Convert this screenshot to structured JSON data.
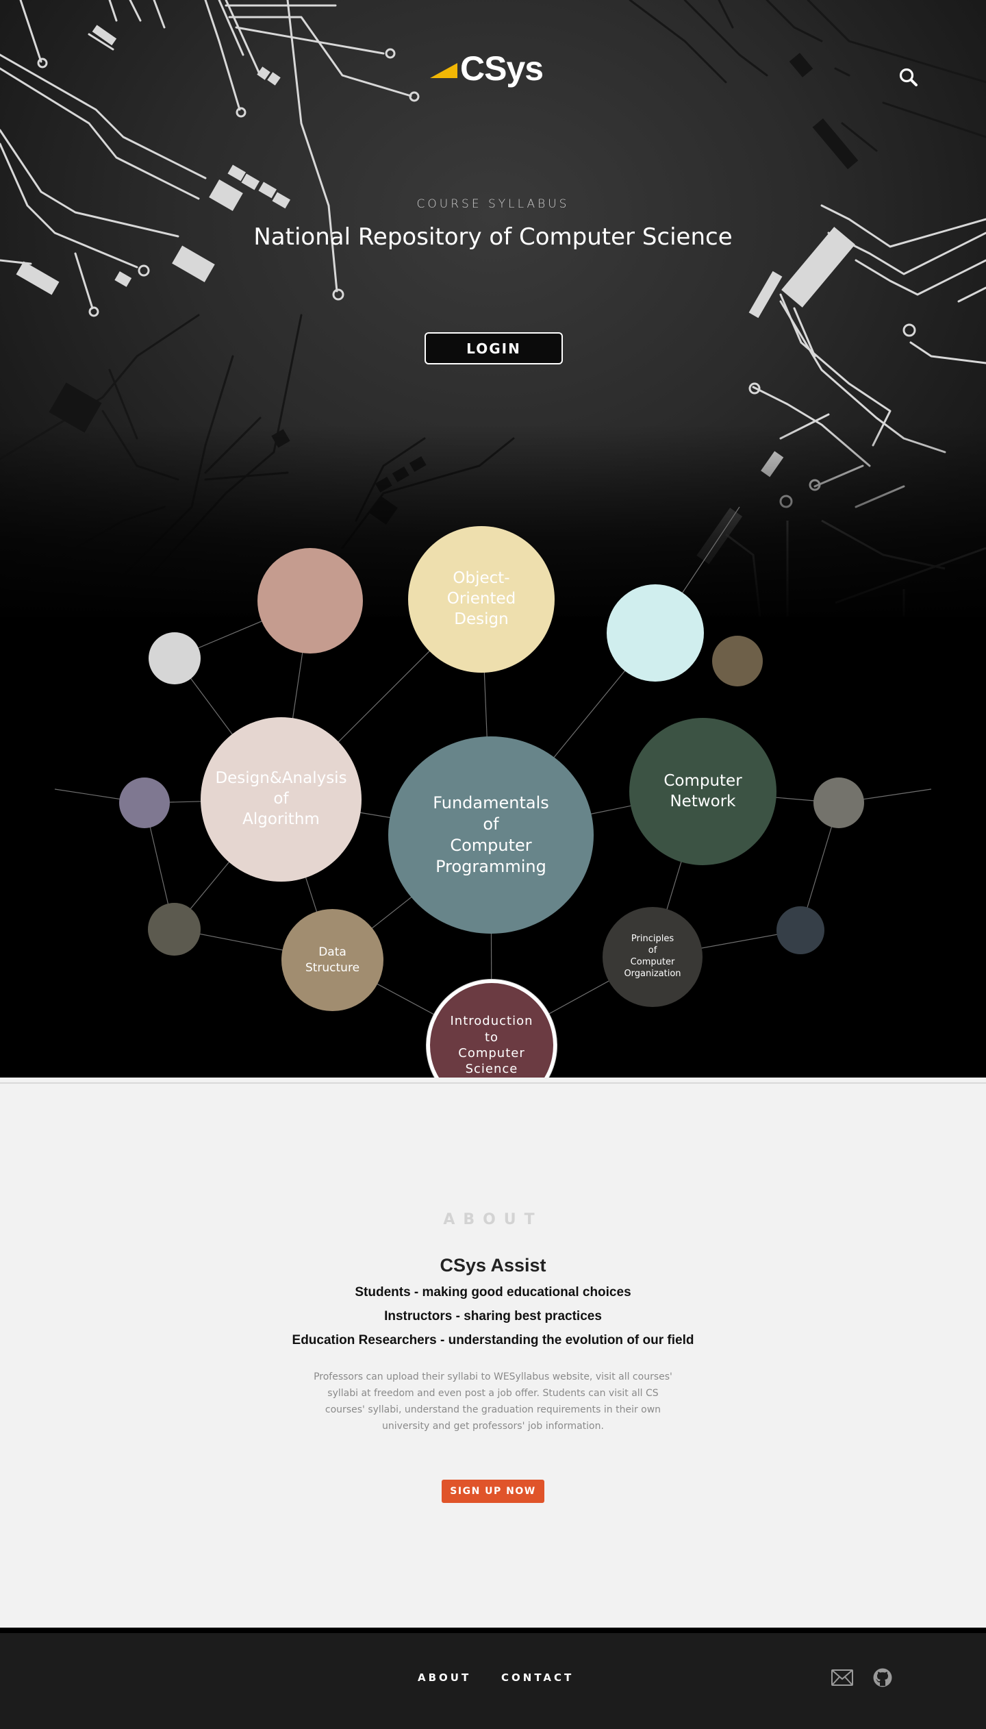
{
  "brand": {
    "name": "CSys",
    "accent": "#f2b705"
  },
  "header": {
    "search_icon": "search-icon"
  },
  "hero": {
    "eyebrow": "COURSE SYLLABUS",
    "title": "National Repository of Computer Science",
    "login_label": "LOGIN"
  },
  "courses": {
    "fundamentals": [
      "Fundamentals",
      "of",
      "Computer",
      "Programming"
    ],
    "oop": [
      "Object-",
      "Oriented",
      "Design"
    ],
    "algorithm": [
      "Design&Analysis",
      "of",
      "Algorithm"
    ],
    "network": [
      "Computer",
      "Network"
    ],
    "data_structure": [
      "Data",
      "Structure"
    ],
    "organization": [
      "Principles",
      "of",
      "Computer",
      "Organization"
    ],
    "intro": [
      "Introduction",
      "to",
      "Computer",
      "Science"
    ]
  },
  "about": {
    "eyebrow": "ABOUT",
    "title": "CSys Assist",
    "lines": [
      "Students - making good educational choices",
      "Instructors - sharing best practices",
      "Education Researchers - understanding the evolution of our field"
    ],
    "body": "Professors can upload their syllabi to WESyllabus website, visit all courses' syllabi at freedom and even post a job offer. Students can visit all CS courses' syllabi, understand the graduation requirements in their own university and get professors' job information.",
    "signup_label": "SIGN UP NOW"
  },
  "footer": {
    "links": [
      "ABOUT",
      "CONTACT"
    ],
    "icons": [
      "mail-icon",
      "github-icon"
    ]
  }
}
